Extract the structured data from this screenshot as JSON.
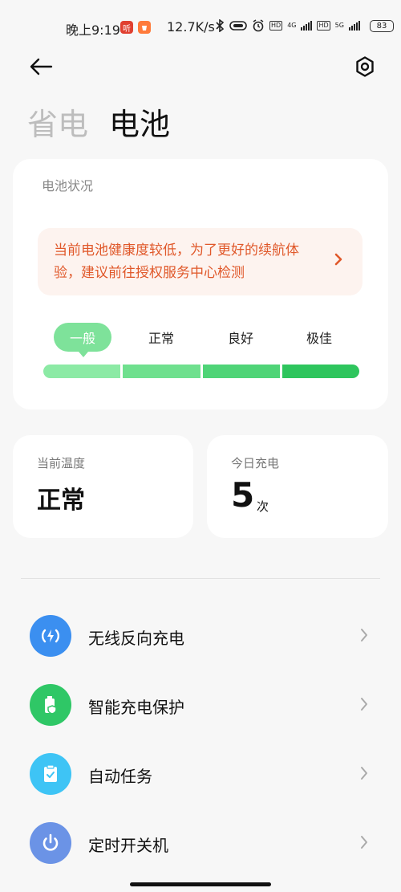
{
  "status_bar": {
    "time": "晚上9:19",
    "app_badge_1": "听",
    "net_speed": "12.7K/s",
    "net_label_1": "4G",
    "net_label_2": "5G",
    "hd_label": "HD",
    "battery": "83"
  },
  "header": {
    "tab_power_saving": "省电",
    "tab_battery": "电池"
  },
  "battery_card": {
    "title": "电池状况",
    "alert_text": "当前电池健康度较低，为了更好的续航体验，建议前往授权服务中心检测",
    "levels": [
      "一般",
      "正常",
      "良好",
      "极佳"
    ],
    "current_level": "一般",
    "level_colors": [
      "#8ceaa5",
      "#6fe08e",
      "#4fd477",
      "#2ec55d"
    ]
  },
  "temperature": {
    "title": "当前温度",
    "value": "正常"
  },
  "charging": {
    "title": "今日充电",
    "count": "5",
    "unit": "次"
  },
  "menu": [
    {
      "label": "无线反向充电",
      "icon": "wireless-charging-icon",
      "color": "#3b8ff0"
    },
    {
      "label": "智能充电保护",
      "icon": "battery-shield-icon",
      "color": "#2fc766"
    },
    {
      "label": "自动任务",
      "icon": "clipboard-check-icon",
      "color": "#3ec4f5"
    },
    {
      "label": "定时开关机",
      "icon": "power-icon",
      "color": "#6b93e6"
    }
  ]
}
